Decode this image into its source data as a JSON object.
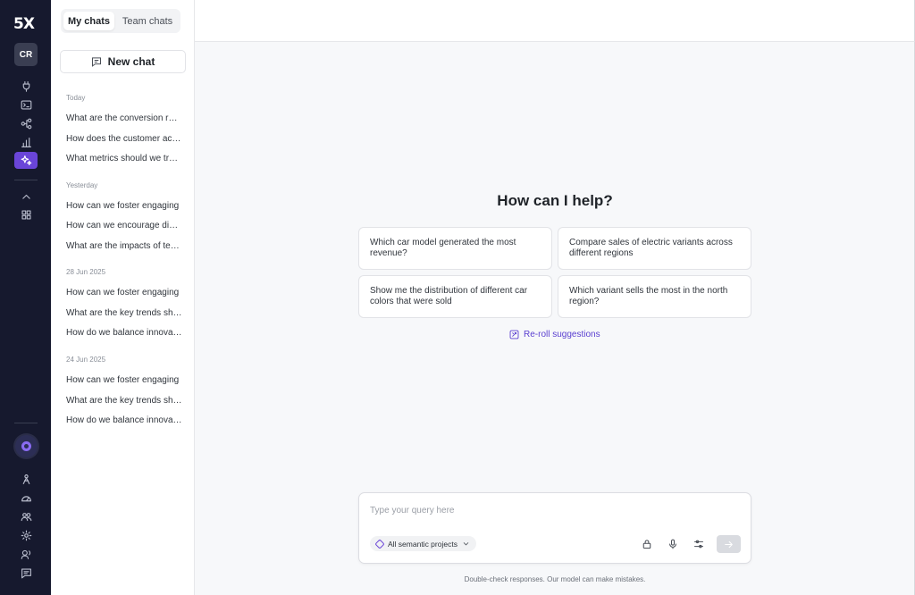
{
  "app": {
    "logo": "5X",
    "user_initials": "CR"
  },
  "rail": {
    "top_icons": [
      "plug-icon",
      "terminal-icon",
      "workflow-icon",
      "bar-chart-icon",
      "sparkles-icon"
    ],
    "mid_icons": [
      "chevron-up-icon",
      "grid-icon"
    ],
    "bottom_icons": [
      "person-icon",
      "gauge-icon",
      "users-icon",
      "gear-icon",
      "support-icon",
      "message-icon"
    ],
    "active_icon": "sparkles-icon",
    "accent": "#6a45d8"
  },
  "tabs": {
    "my_chats": "My chats",
    "team_chats": "Team chats",
    "selected": "My chats"
  },
  "new_chat_label": "New chat",
  "history": {
    "groups": [
      {
        "label": "Today",
        "items": [
          "What are the conversion rates",
          "How does the customer acquisition",
          "What metrics should we track"
        ]
      },
      {
        "label": "Yesterday",
        "items": [
          "How can we foster engaging",
          "How can we encourage diverse",
          "What are the impacts of technology"
        ]
      },
      {
        "label": "28 Jun 2025",
        "items": [
          "How can we foster engaging",
          "What are the key trends shaping",
          "How do we balance innovation"
        ]
      },
      {
        "label": "24 Jun 2025",
        "items": [
          "How can we foster engaging",
          "What are the key trends shaping",
          "How do we balance innovation"
        ]
      }
    ]
  },
  "main": {
    "heading": "How can I help?",
    "suggestions": [
      "Which car model generated the most revenue?",
      "Compare sales of electric variants across different regions",
      "Show me the distribution of different car colors that were sold",
      "Which variant sells the most in the north region?"
    ],
    "reroll_label": "Re-roll suggestions"
  },
  "composer": {
    "placeholder": "Type your query here",
    "value": "",
    "project_selector": "All semantic projects",
    "tools": [
      "lock-icon",
      "microphone-icon",
      "sliders-icon"
    ]
  },
  "disclaimer": "Double-check responses. Our model can make mistakes."
}
